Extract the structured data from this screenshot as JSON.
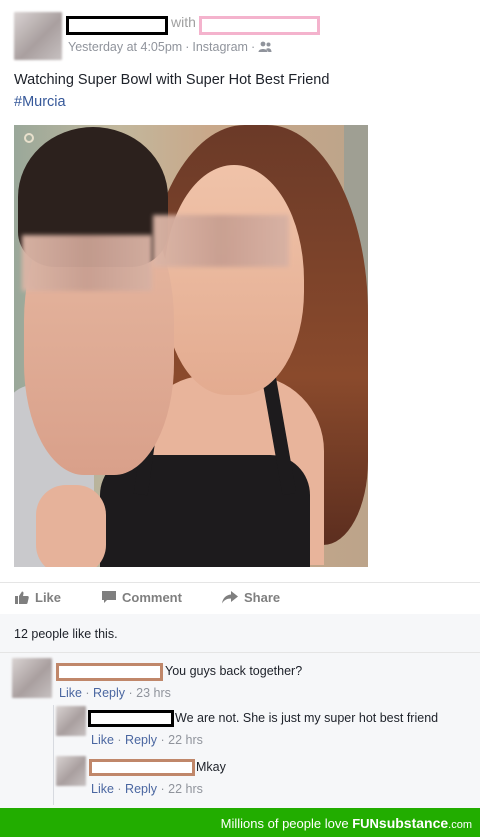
{
  "post": {
    "with_label": "with",
    "timestamp": "Yesterday at 4:05pm",
    "source": "Instagram",
    "privacy_icon": "friends-icon",
    "status_text": "Watching Super Bowl with Super Hot Best Friend",
    "hashtag": "#Murcia"
  },
  "actions": {
    "like": "Like",
    "comment": "Comment",
    "share": "Share"
  },
  "likes_summary": "12 people like this.",
  "comments": [
    {
      "text": "You guys back together?",
      "like": "Like",
      "reply": "Reply",
      "time": "23 hrs"
    },
    {
      "text": "We are not. She is just my super hot best friend",
      "like": "Like",
      "reply": "Reply",
      "time": "22 hrs"
    },
    {
      "text": "Mkay",
      "like": "Like",
      "reply": "Reply",
      "time": "22 hrs"
    }
  ],
  "footer": {
    "lead": "Millions of people love",
    "brand_fun": "FUN",
    "brand_substance": "substance",
    "brand_tld": ".com"
  },
  "colors": {
    "link": "#365899",
    "footer_green": "#22ad00",
    "censor_pink": "#f4b3cd",
    "censor_brown": "#c0876a"
  }
}
